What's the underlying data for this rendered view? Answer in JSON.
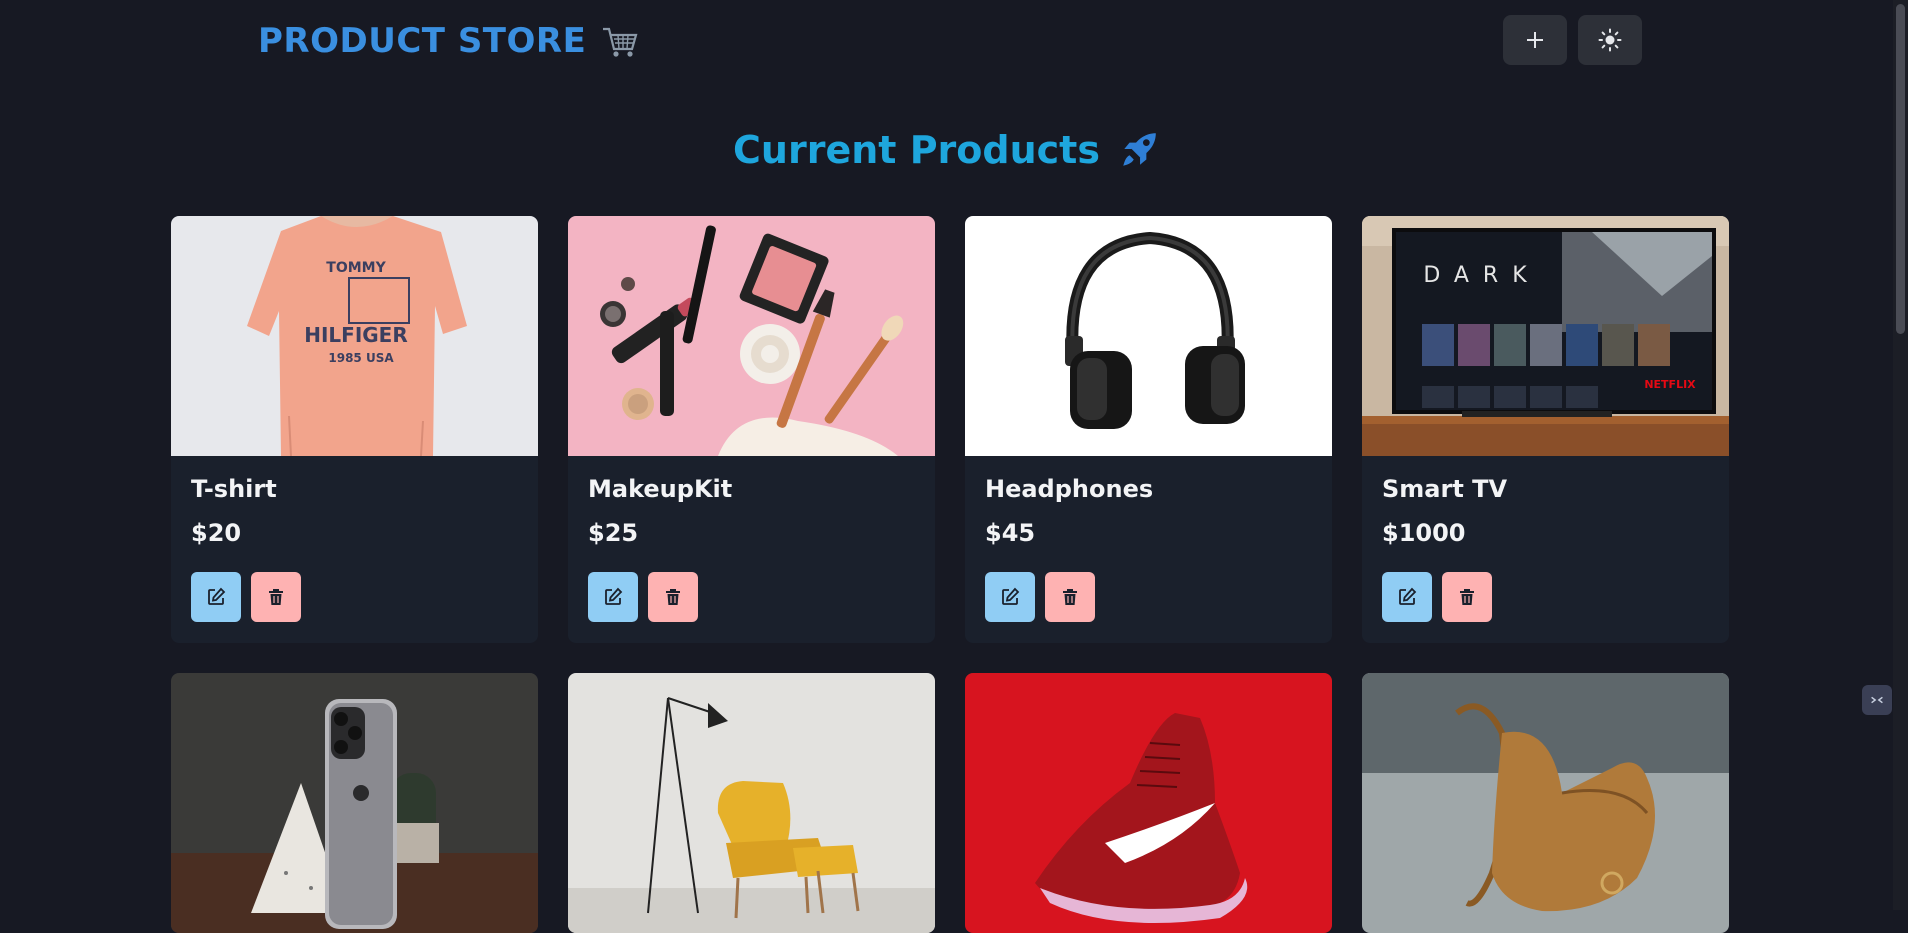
{
  "navbar": {
    "brand": "PRODUCT STORE",
    "brand_icon": "shopping-cart-icon",
    "add_icon": "plus-icon",
    "theme_icon": "sun-icon"
  },
  "heading": {
    "title": "Current Products",
    "icon": "rocket-icon"
  },
  "products": [
    {
      "name": "T-shirt",
      "price": "$20",
      "image": "tshirt"
    },
    {
      "name": "MakeupKit",
      "price": "$25",
      "image": "makeup"
    },
    {
      "name": "Headphones",
      "price": "$45",
      "image": "headphones"
    },
    {
      "name": "Smart TV",
      "price": "$1000",
      "image": "tv"
    },
    {
      "name": "",
      "price": "",
      "image": "phone"
    },
    {
      "name": "",
      "price": "",
      "image": "chair"
    },
    {
      "name": "",
      "price": "",
      "image": "sneaker"
    },
    {
      "name": "",
      "price": "",
      "image": "bag"
    }
  ],
  "tv_screen": {
    "title": "DARK",
    "brand": "NETFLIX"
  },
  "tshirt_print": {
    "top": "TOMMY",
    "middle": "HILFIGER",
    "bottom": "1985 USA"
  },
  "colors": {
    "background": "#171923",
    "card": "#1a202c",
    "brand": "#3a8fe0",
    "heading": "#1ea6dd",
    "edit": "#90cdf4",
    "delete": "#feb2b2"
  }
}
